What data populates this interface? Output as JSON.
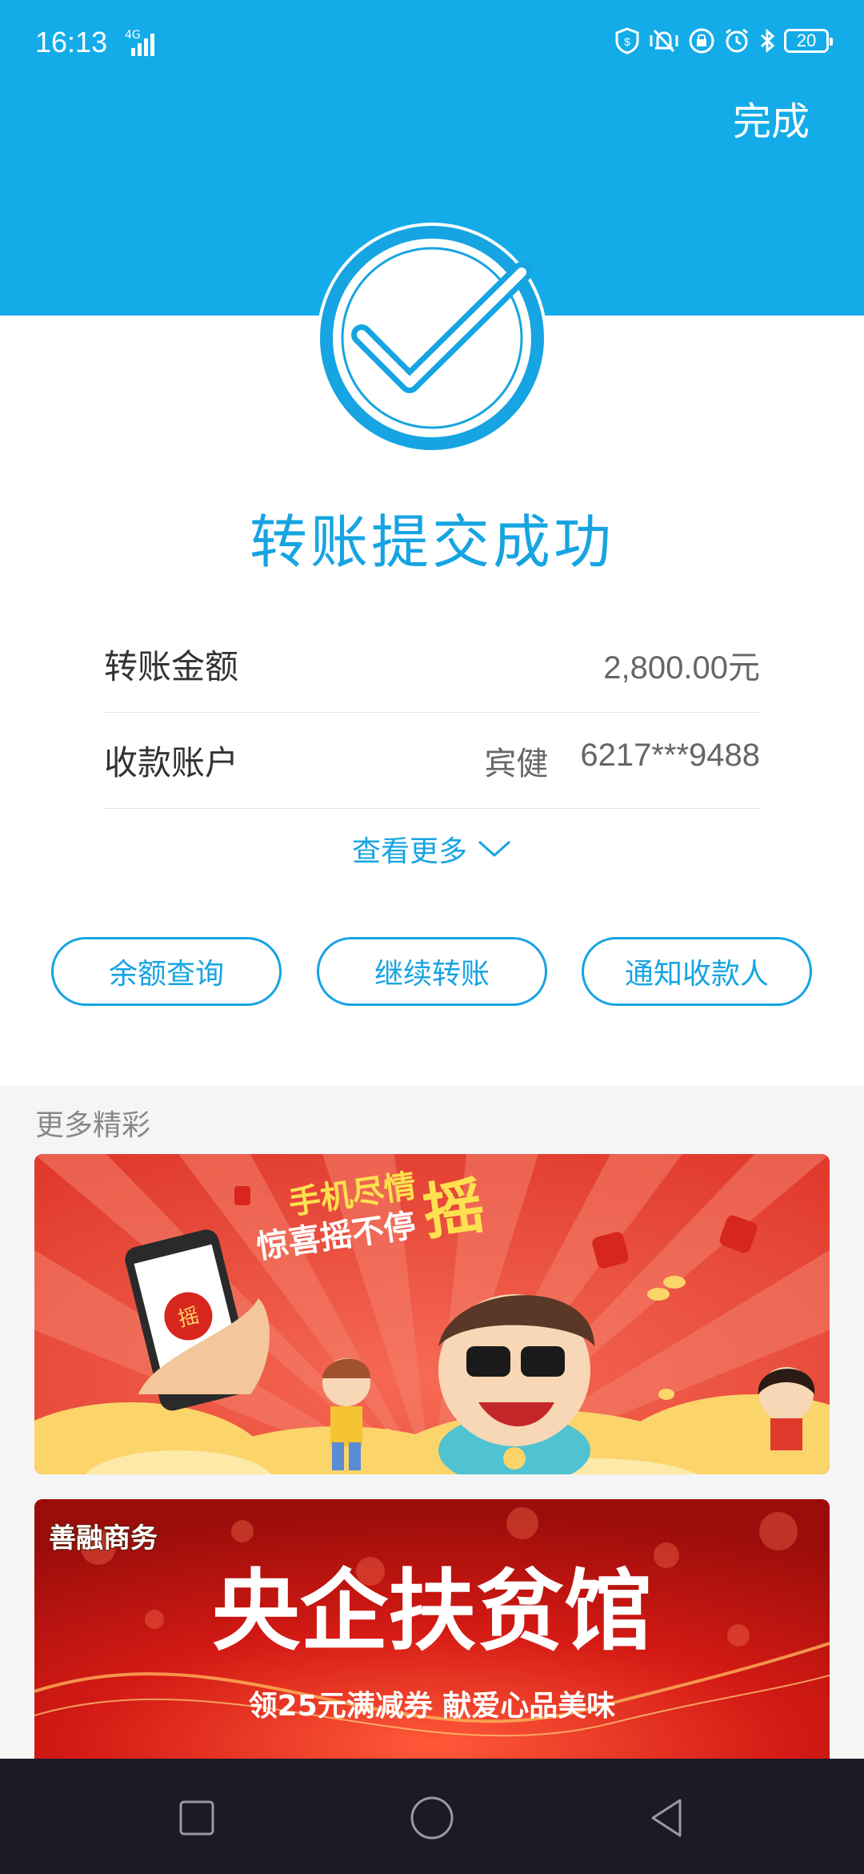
{
  "status_bar": {
    "time": "16:13",
    "network": "4G",
    "battery": "20"
  },
  "header": {
    "done_label": "完成",
    "accent_color": "#13ace9"
  },
  "result": {
    "title": "转账提交成功",
    "icon": "checkmark-circle-icon"
  },
  "details": {
    "amount_label": "转账金额",
    "amount_value": "2,800.00元",
    "account_label": "收款账户",
    "account_name": "宾健",
    "account_number": "6217***9488"
  },
  "more_link": {
    "label": "查看更多",
    "icon": "chevron-down-icon"
  },
  "actions": {
    "balance_label": "余额查询",
    "continue_label": "继续转账",
    "notify_label": "通知收款人"
  },
  "more_section": {
    "title": "更多精彩",
    "banner_shake": {
      "line1": "手机尽情",
      "big": "摇",
      "line2": "惊喜摇不停",
      "phone_badge": "摇"
    },
    "banner_charity": {
      "brand": "善融商务",
      "headline": "央企扶贫馆",
      "subline": "领25元满减券 献爱心品美味"
    }
  },
  "nav": {
    "recent": "square-icon",
    "home": "circle-icon",
    "back": "triangle-back-icon"
  }
}
